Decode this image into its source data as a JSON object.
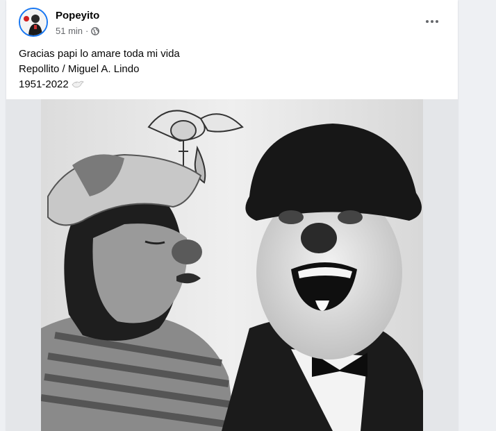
{
  "post": {
    "author": "Popeyito",
    "time": "51 min",
    "separator": "·",
    "text_lines": [
      "Gracias papi lo amare toda mi vida",
      "Repollito / Miguel A. Lindo",
      "1951-2022"
    ],
    "icons": {
      "audience": "globe-icon",
      "more": "more-options-icon",
      "emoji": "dove-emoji-icon"
    }
  },
  "colors": {
    "accent": "#1877f2",
    "secondary_text": "#65676b",
    "primary_text": "#050505"
  }
}
